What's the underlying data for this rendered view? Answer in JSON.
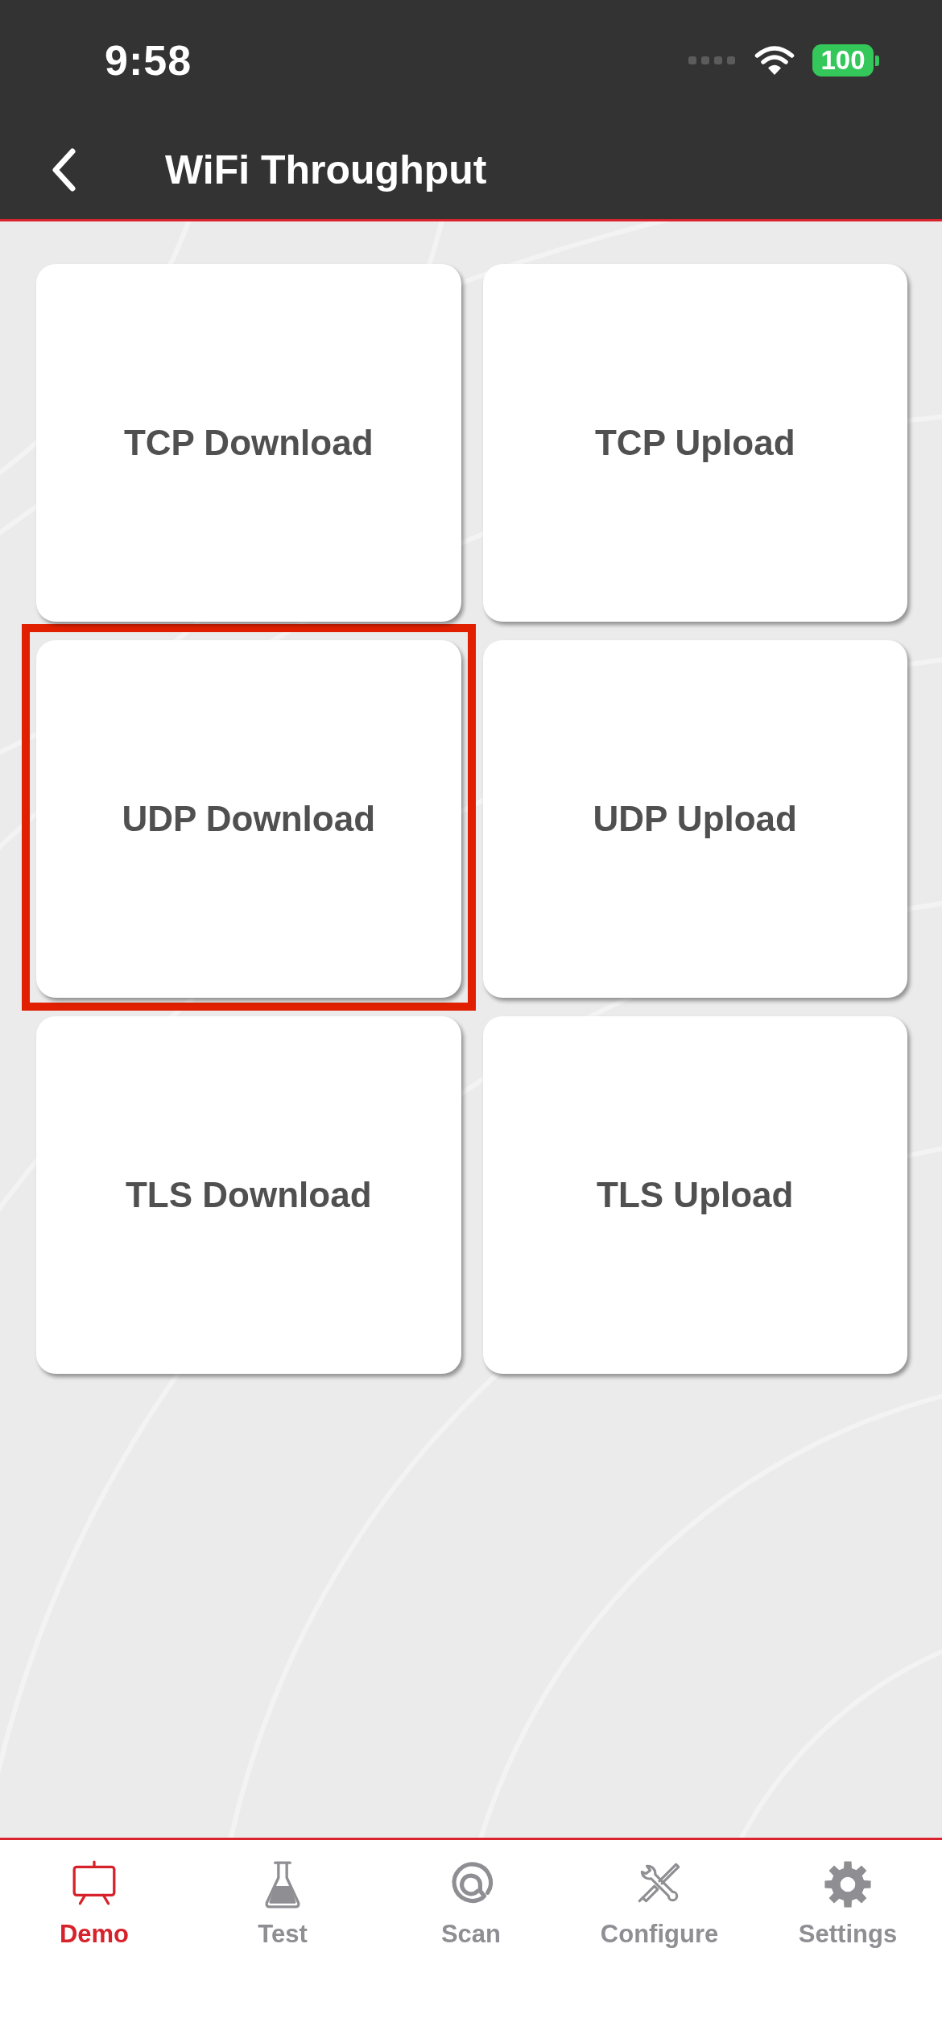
{
  "status_bar": {
    "time": "9:58",
    "battery": "100"
  },
  "header": {
    "title": "WiFi Throughput"
  },
  "tests": [
    {
      "label": "TCP Download",
      "selected": false
    },
    {
      "label": "TCP Upload",
      "selected": false
    },
    {
      "label": "UDP Download",
      "selected": true
    },
    {
      "label": "UDP Upload",
      "selected": false
    },
    {
      "label": "TLS Download",
      "selected": false
    },
    {
      "label": "TLS Upload",
      "selected": false
    }
  ],
  "tab_bar": {
    "items": [
      {
        "label": "Demo",
        "selected": true
      },
      {
        "label": "Test",
        "selected": false
      },
      {
        "label": "Scan",
        "selected": false
      },
      {
        "label": "Configure",
        "selected": false
      },
      {
        "label": "Settings",
        "selected": false
      }
    ]
  }
}
